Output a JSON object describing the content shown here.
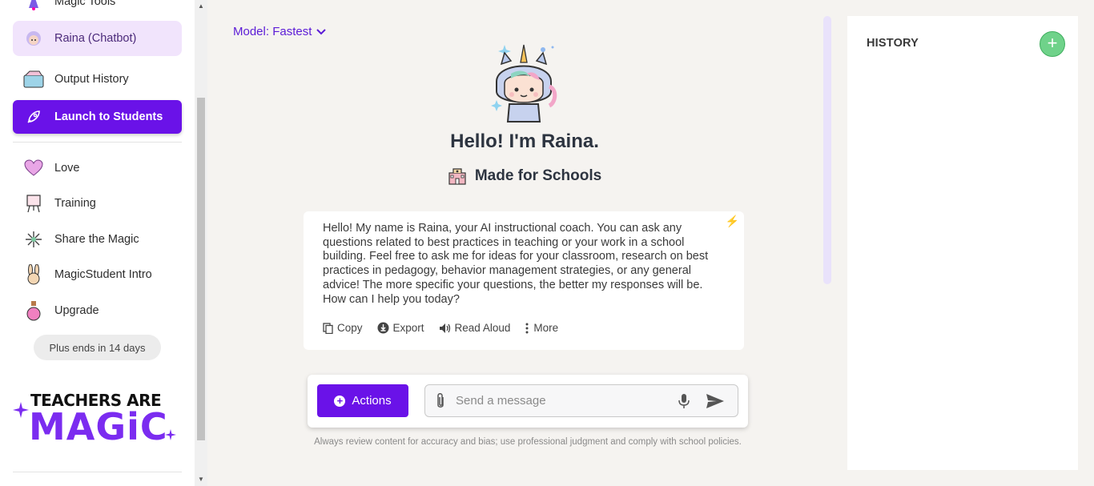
{
  "sidebar": {
    "items": [
      {
        "label": "Magic Tools",
        "icon": "wizard-icon"
      },
      {
        "label": "Raina (Chatbot)",
        "icon": "raina-avatar-icon"
      },
      {
        "label": "Output History",
        "icon": "folder-icon"
      },
      {
        "label": "Launch to Students",
        "icon": "rocket-icon"
      },
      {
        "label": "Love",
        "icon": "heart-icon"
      },
      {
        "label": "Training",
        "icon": "easel-icon"
      },
      {
        "label": "Share the Magic",
        "icon": "sparkle-icon"
      },
      {
        "label": "MagicStudent Intro",
        "icon": "bunny-icon"
      },
      {
        "label": "Upgrade",
        "icon": "potion-icon"
      }
    ],
    "plan_badge": "Plus ends in 14 days",
    "logo_line1": "TEACHERS ARE",
    "logo_line2": "MAGiC"
  },
  "main": {
    "model_selector": "Model: Fastest",
    "greeting": "Hello! I'm Raina.",
    "tagline": "Made for Schools",
    "message": "Hello! My name is Raina, your AI instructional coach. You can ask any questions related to best practices in teaching or your work in a school building. Feel free to ask me for ideas for your classroom, research on best practices in pedagogy, behavior management strategies, or any general advice! The more specific your questions, the better my responses will be. How can I help you today?",
    "message_actions": {
      "copy": "Copy",
      "export": "Export",
      "read_aloud": "Read Aloud",
      "more": "More"
    },
    "composer": {
      "actions_label": "Actions",
      "placeholder": "Send a message"
    },
    "disclaimer": "Always review content for accuracy and bias; use professional judgment and comply with school policies."
  },
  "history": {
    "title": "HISTORY"
  },
  "colors": {
    "accent": "#6a12e8",
    "active_bg": "#f1e4fc",
    "add_button": "#6fd28a"
  }
}
